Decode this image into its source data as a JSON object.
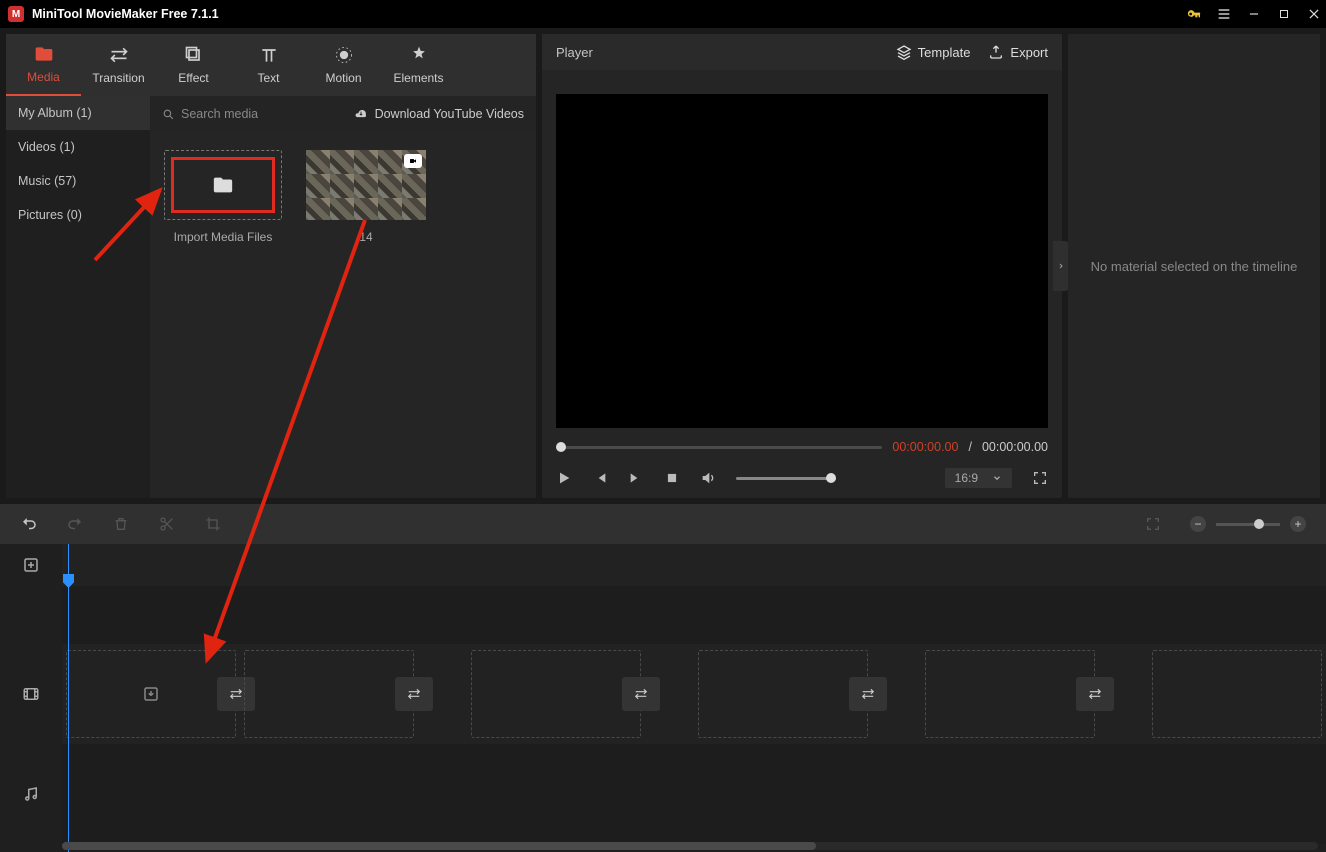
{
  "titlebar": {
    "title": "MiniTool MovieMaker Free 7.1.1"
  },
  "toptabs": [
    {
      "label": "Media"
    },
    {
      "label": "Transition"
    },
    {
      "label": "Effect"
    },
    {
      "label": "Text"
    },
    {
      "label": "Motion"
    },
    {
      "label": "Elements"
    }
  ],
  "sidebar": {
    "items": [
      {
        "label": "My Album (1)"
      },
      {
        "label": "Videos (1)"
      },
      {
        "label": "Music (57)"
      },
      {
        "label": "Pictures (0)"
      }
    ]
  },
  "search": {
    "placeholder": "Search media"
  },
  "download_link": "Download YouTube Videos",
  "thumbs": {
    "import_label": "Import Media Files",
    "clip_label": "14"
  },
  "player": {
    "title": "Player",
    "template": "Template",
    "export": "Export",
    "time_cur": "00:00:00.00",
    "time_sep": "/",
    "time_tot": "00:00:00.00",
    "aspect": "16:9"
  },
  "props": {
    "empty": "No material selected on the timeline"
  }
}
